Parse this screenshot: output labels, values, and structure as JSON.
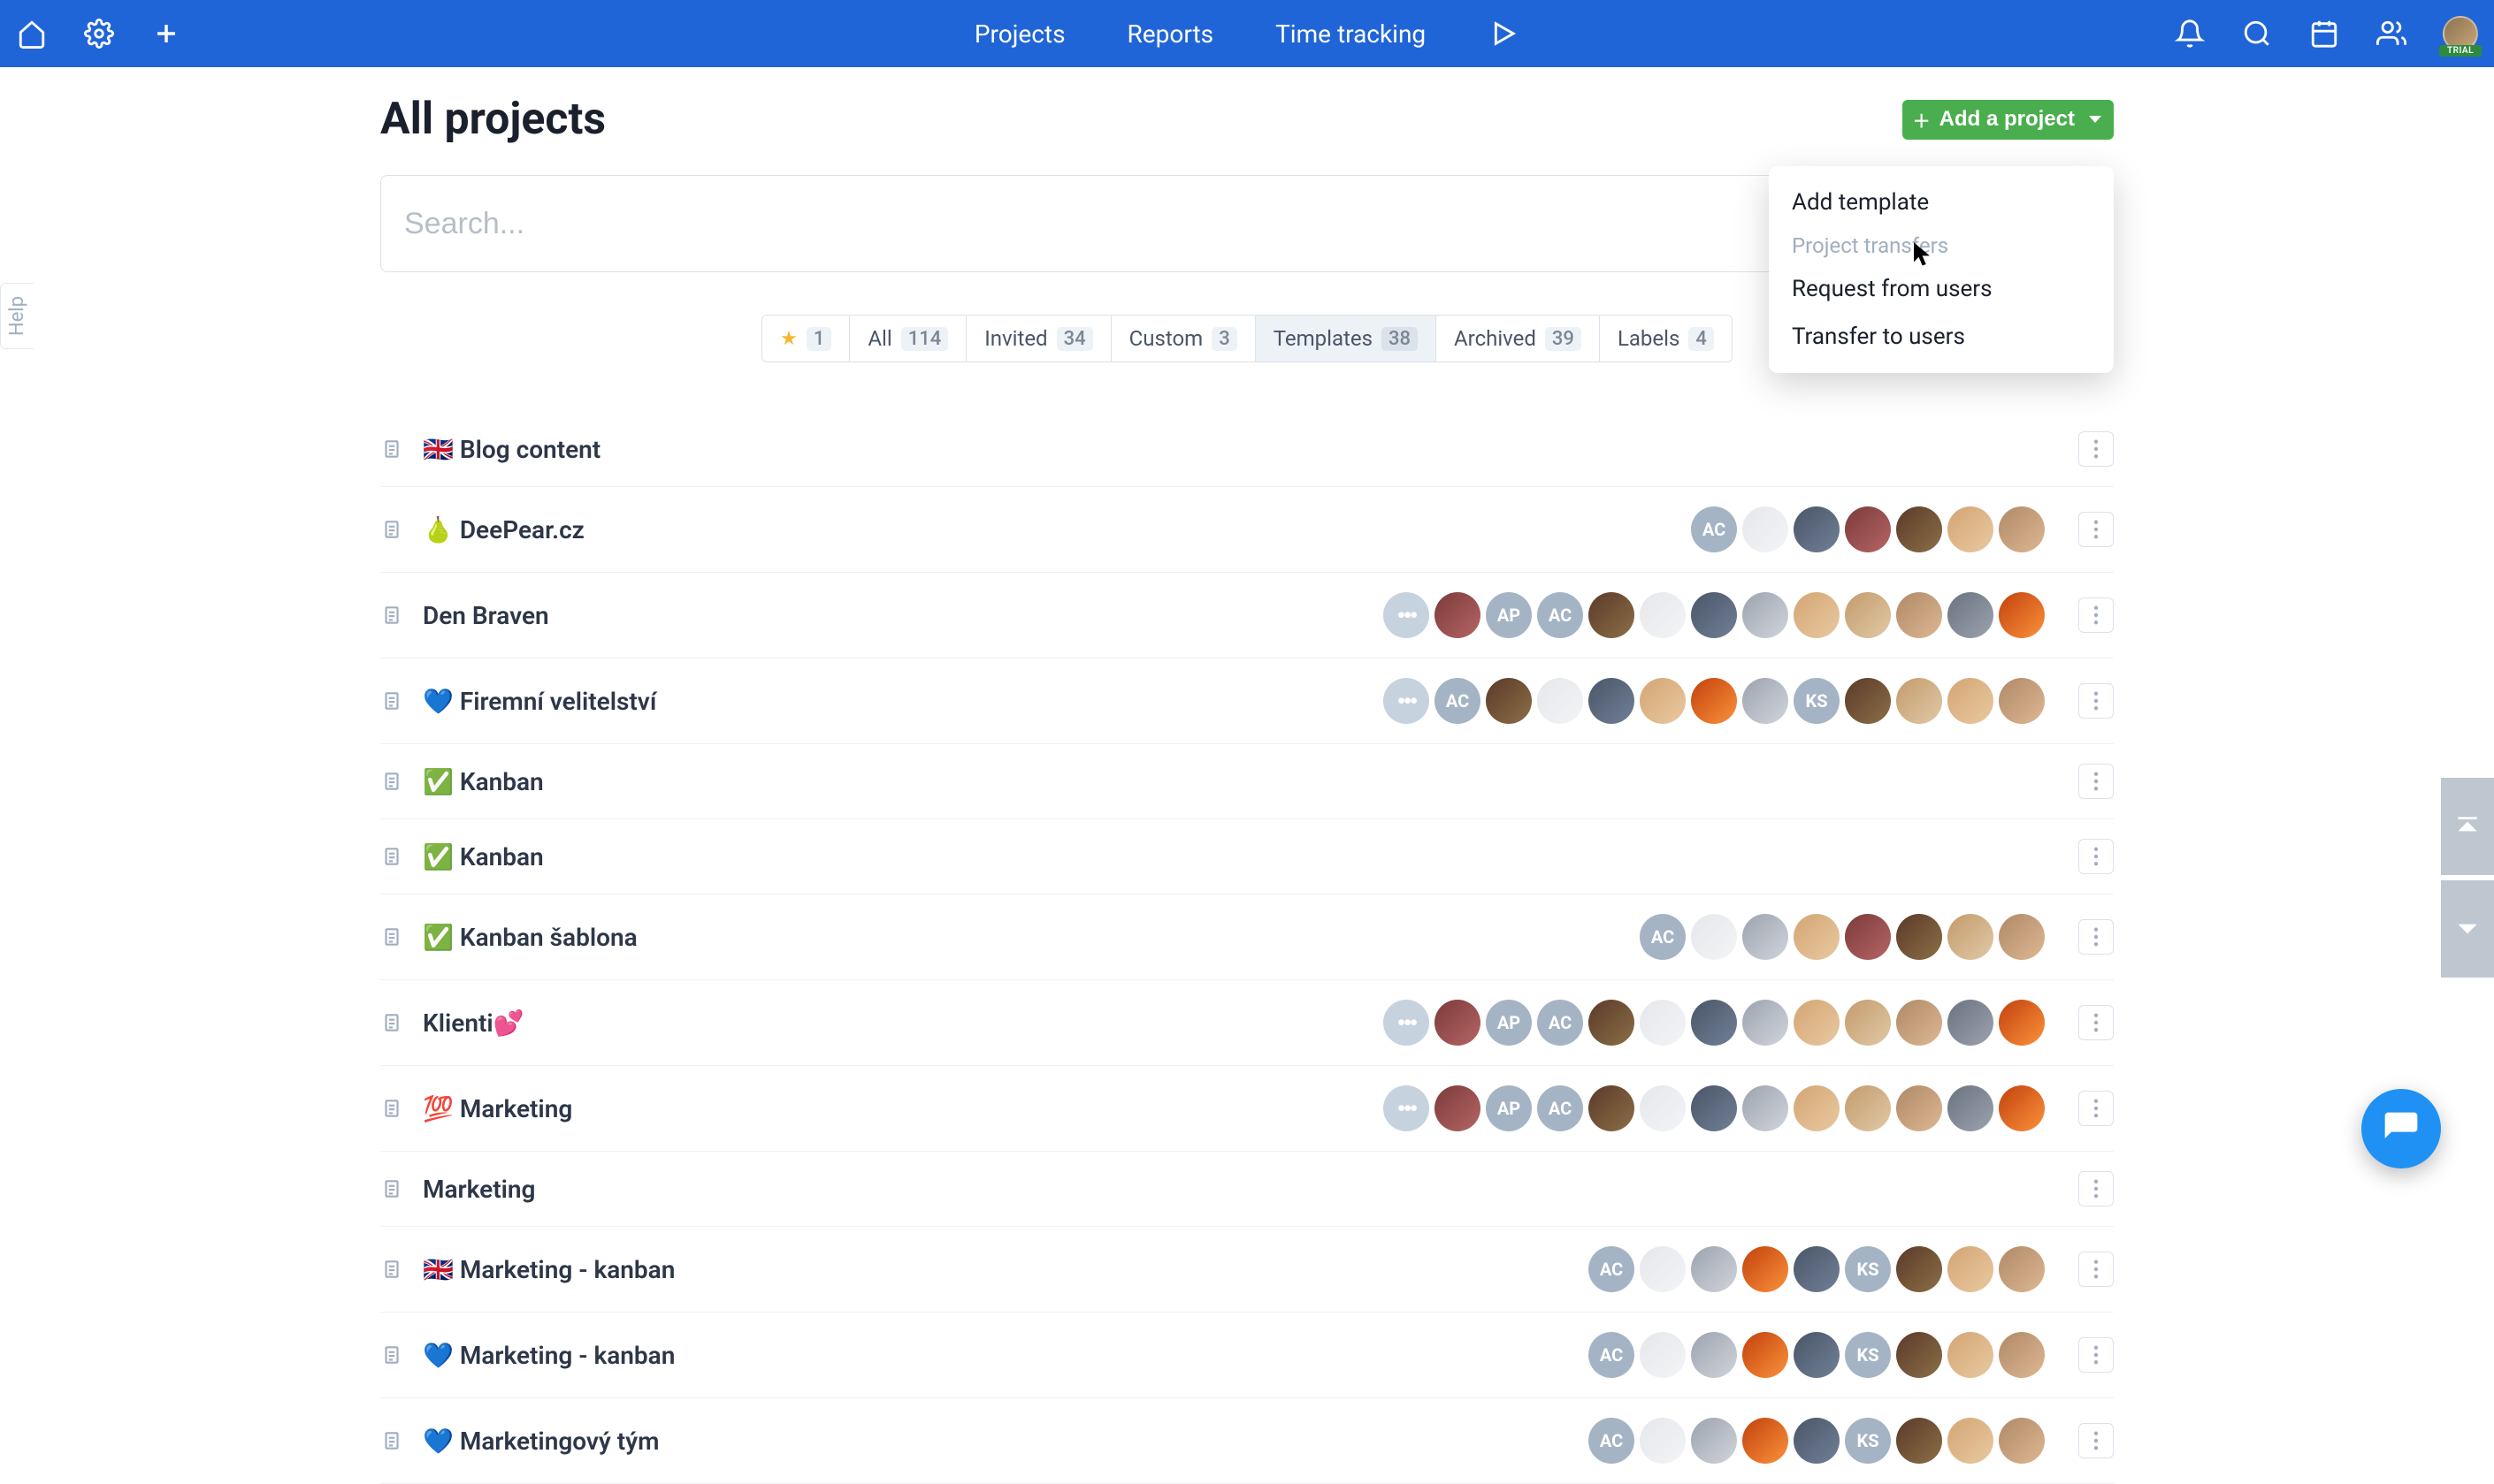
{
  "header": {
    "nav": {
      "projects": "Projects",
      "reports": "Reports",
      "time_tracking": "Time tracking"
    },
    "trial_label": "TRIAL"
  },
  "help_label": "Help",
  "page": {
    "title": "All projects",
    "add_button": "Add a project",
    "search_placeholder": "Search..."
  },
  "dropdown": {
    "add_template": "Add template",
    "section_header": "Project transfers",
    "request_from_users": "Request from users",
    "transfer_to_users": "Transfer to users"
  },
  "tabs": {
    "starred": {
      "count": "1"
    },
    "all": {
      "label": "All",
      "count": "114"
    },
    "invited": {
      "label": "Invited",
      "count": "34"
    },
    "custom": {
      "label": "Custom",
      "count": "3"
    },
    "templates": {
      "label": "Templates",
      "count": "38"
    },
    "archived": {
      "label": "Archived",
      "count": "39"
    },
    "labels": {
      "label": "Labels",
      "count": "4"
    }
  },
  "projects": [
    {
      "emoji": "🇬🇧",
      "name": "Blog content",
      "members": []
    },
    {
      "emoji": "🍐",
      "name": "DeePear.cz",
      "members": [
        {
          "t": "txt",
          "v": "AC"
        },
        {
          "t": "img9"
        },
        {
          "t": "img5"
        },
        {
          "t": "img4"
        },
        {
          "t": "img1"
        },
        {
          "t": "img2"
        },
        {
          "t": "img7"
        }
      ]
    },
    {
      "emoji": "",
      "name": "Den Braven",
      "members": [
        {
          "t": "more",
          "v": "•••"
        },
        {
          "t": "img4"
        },
        {
          "t": "txt",
          "v": "AP"
        },
        {
          "t": "txt",
          "v": "AC"
        },
        {
          "t": "img1"
        },
        {
          "t": "img9"
        },
        {
          "t": "img5"
        },
        {
          "t": "img3"
        },
        {
          "t": "img2"
        },
        {
          "t": "img6"
        },
        {
          "t": "img7"
        },
        {
          "t": "img8"
        },
        {
          "t": "img10"
        }
      ]
    },
    {
      "emoji": "💙",
      "name": "Firemní velitelství",
      "members": [
        {
          "t": "more",
          "v": "•••"
        },
        {
          "t": "txt",
          "v": "AC"
        },
        {
          "t": "img1"
        },
        {
          "t": "img9"
        },
        {
          "t": "img5"
        },
        {
          "t": "img2"
        },
        {
          "t": "img10"
        },
        {
          "t": "img3"
        },
        {
          "t": "txt",
          "v": "KS"
        },
        {
          "t": "img1"
        },
        {
          "t": "img6"
        },
        {
          "t": "img2"
        },
        {
          "t": "img7"
        }
      ]
    },
    {
      "emoji": "✅",
      "name": "Kanban",
      "members": []
    },
    {
      "emoji": "✅",
      "name": "Kanban",
      "members": []
    },
    {
      "emoji": "✅",
      "name": "Kanban šablona",
      "members": [
        {
          "t": "txt",
          "v": "AC"
        },
        {
          "t": "img9"
        },
        {
          "t": "img3"
        },
        {
          "t": "img2"
        },
        {
          "t": "img4"
        },
        {
          "t": "img1"
        },
        {
          "t": "img6"
        },
        {
          "t": "img7"
        }
      ]
    },
    {
      "emoji": "",
      "name": "Klienti💕",
      "members": [
        {
          "t": "more",
          "v": "•••"
        },
        {
          "t": "img4"
        },
        {
          "t": "txt",
          "v": "AP"
        },
        {
          "t": "txt",
          "v": "AC"
        },
        {
          "t": "img1"
        },
        {
          "t": "img9"
        },
        {
          "t": "img5"
        },
        {
          "t": "img3"
        },
        {
          "t": "img2"
        },
        {
          "t": "img6"
        },
        {
          "t": "img7"
        },
        {
          "t": "img8"
        },
        {
          "t": "img10"
        }
      ]
    },
    {
      "emoji": "💯",
      "name": "Marketing",
      "members": [
        {
          "t": "more",
          "v": "•••"
        },
        {
          "t": "img4"
        },
        {
          "t": "txt",
          "v": "AP"
        },
        {
          "t": "txt",
          "v": "AC"
        },
        {
          "t": "img1"
        },
        {
          "t": "img9"
        },
        {
          "t": "img5"
        },
        {
          "t": "img3"
        },
        {
          "t": "img2"
        },
        {
          "t": "img6"
        },
        {
          "t": "img7"
        },
        {
          "t": "img8"
        },
        {
          "t": "img10"
        }
      ]
    },
    {
      "emoji": "",
      "name": "Marketing",
      "members": []
    },
    {
      "emoji": "🇬🇧",
      "name": "Marketing - kanban",
      "members": [
        {
          "t": "txt",
          "v": "AC"
        },
        {
          "t": "img9"
        },
        {
          "t": "img3"
        },
        {
          "t": "img10"
        },
        {
          "t": "img5"
        },
        {
          "t": "txt",
          "v": "KS"
        },
        {
          "t": "img1"
        },
        {
          "t": "img2"
        },
        {
          "t": "img7"
        }
      ]
    },
    {
      "emoji": "💙",
      "name": "Marketing - kanban",
      "members": [
        {
          "t": "txt",
          "v": "AC"
        },
        {
          "t": "img9"
        },
        {
          "t": "img3"
        },
        {
          "t": "img10"
        },
        {
          "t": "img5"
        },
        {
          "t": "txt",
          "v": "KS"
        },
        {
          "t": "img1"
        },
        {
          "t": "img2"
        },
        {
          "t": "img7"
        }
      ]
    },
    {
      "emoji": "💙",
      "name": "Marketingový tým",
      "members": [
        {
          "t": "txt",
          "v": "AC"
        },
        {
          "t": "img9"
        },
        {
          "t": "img3"
        },
        {
          "t": "img10"
        },
        {
          "t": "img5"
        },
        {
          "t": "txt",
          "v": "KS"
        },
        {
          "t": "img1"
        },
        {
          "t": "img2"
        },
        {
          "t": "img7"
        }
      ]
    }
  ]
}
